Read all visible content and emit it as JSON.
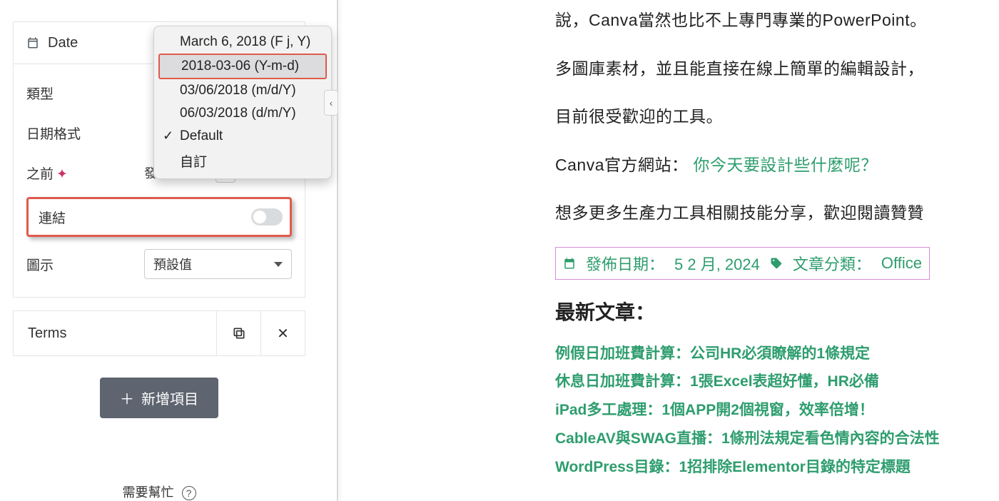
{
  "sidebar": {
    "panel_title": "Date",
    "fields": {
      "type_label": "類型",
      "date_format_label": "日期格式",
      "before_label": "之前",
      "before_value": "發佈日期：",
      "link_label": "連結",
      "link_on": false,
      "icon_label": "圖示",
      "icon_select_value": "預設值"
    },
    "terms_label": "Terms",
    "add_item_label": "新增項目",
    "help_text": "需要幫忙"
  },
  "dropdown": {
    "options": [
      {
        "text": "March 6, 2018 (F j, Y)",
        "selected": false,
        "check": false
      },
      {
        "text": "2018-03-06 (Y-m-d)",
        "selected": true,
        "check": false
      },
      {
        "text": "03/06/2018 (m/d/Y)",
        "selected": false,
        "check": false
      },
      {
        "text": "06/03/2018 (d/m/Y)",
        "selected": false,
        "check": false
      },
      {
        "text": "Default",
        "selected": false,
        "check": true
      },
      {
        "text": "自訂",
        "selected": false,
        "check": false
      }
    ]
  },
  "article": {
    "p1": "說，Canva當然也比不上專門專業的PowerPoint。",
    "p2": "多圖庫素材，並且能直接在線上簡單的編輯設計，",
    "p3": "目前很受歡迎的工具。",
    "p4_prefix": "Canva官方網站：",
    "p4_link": "你今天要設計些什麼呢？",
    "p5": "想多更多生產力工具相關技能分享，歡迎閱讀贊贊",
    "meta": {
      "date_label": "發佈日期：",
      "date_value": "5 2 月, 2024",
      "cat_label": "文章分類：",
      "cat_value": "Office"
    },
    "latest_heading": "最新文章：",
    "latest": [
      "例假日加班費計算：公司HR必須瞭解的1條規定",
      "休息日加班費計算：1張Excel表超好懂，HR必備",
      "iPad多工處理：1個APP開2個視窗，效率倍增！",
      "CableAV與SWAG直播：1條刑法規定看色情內容的合法性",
      "WordPress目錄：1招排除Elementor目錄的特定標題"
    ]
  }
}
